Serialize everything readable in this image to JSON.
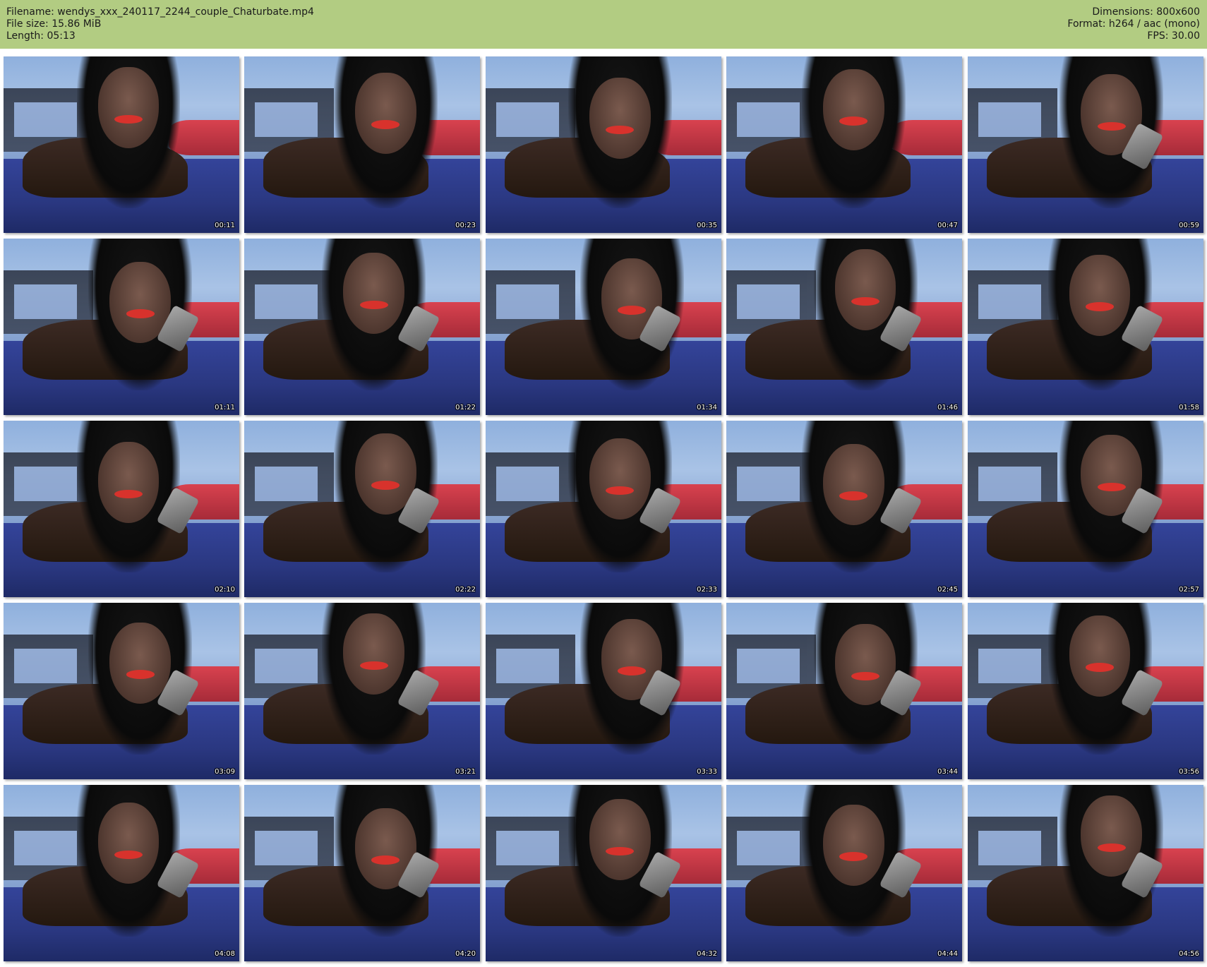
{
  "header": {
    "filename": "Filename: wendys_xxx_240117_2244_couple_Chaturbate.mp4",
    "filesize": "File size: 15.86 MiB",
    "length": "Length: 05:13",
    "dimensions": "Dimensions: 800x600",
    "format": "Format: h264 / aac (mono)",
    "fps": "FPS: 30.00"
  },
  "colors": {
    "header_bg": "#b2cc82",
    "page_bg": "#ffffff"
  },
  "thumbnails": [
    {
      "time": "00:11"
    },
    {
      "time": "00:23"
    },
    {
      "time": "00:35"
    },
    {
      "time": "00:47"
    },
    {
      "time": "00:59"
    },
    {
      "time": "01:11"
    },
    {
      "time": "01:22"
    },
    {
      "time": "01:34"
    },
    {
      "time": "01:46"
    },
    {
      "time": "01:58"
    },
    {
      "time": "02:10"
    },
    {
      "time": "02:22"
    },
    {
      "time": "02:33"
    },
    {
      "time": "02:45"
    },
    {
      "time": "02:57"
    },
    {
      "time": "03:09"
    },
    {
      "time": "03:21"
    },
    {
      "time": "03:33"
    },
    {
      "time": "03:44"
    },
    {
      "time": "03:56"
    },
    {
      "time": "04:08"
    },
    {
      "time": "04:20"
    },
    {
      "time": "04:32"
    },
    {
      "time": "04:44"
    },
    {
      "time": "04:56"
    }
  ]
}
